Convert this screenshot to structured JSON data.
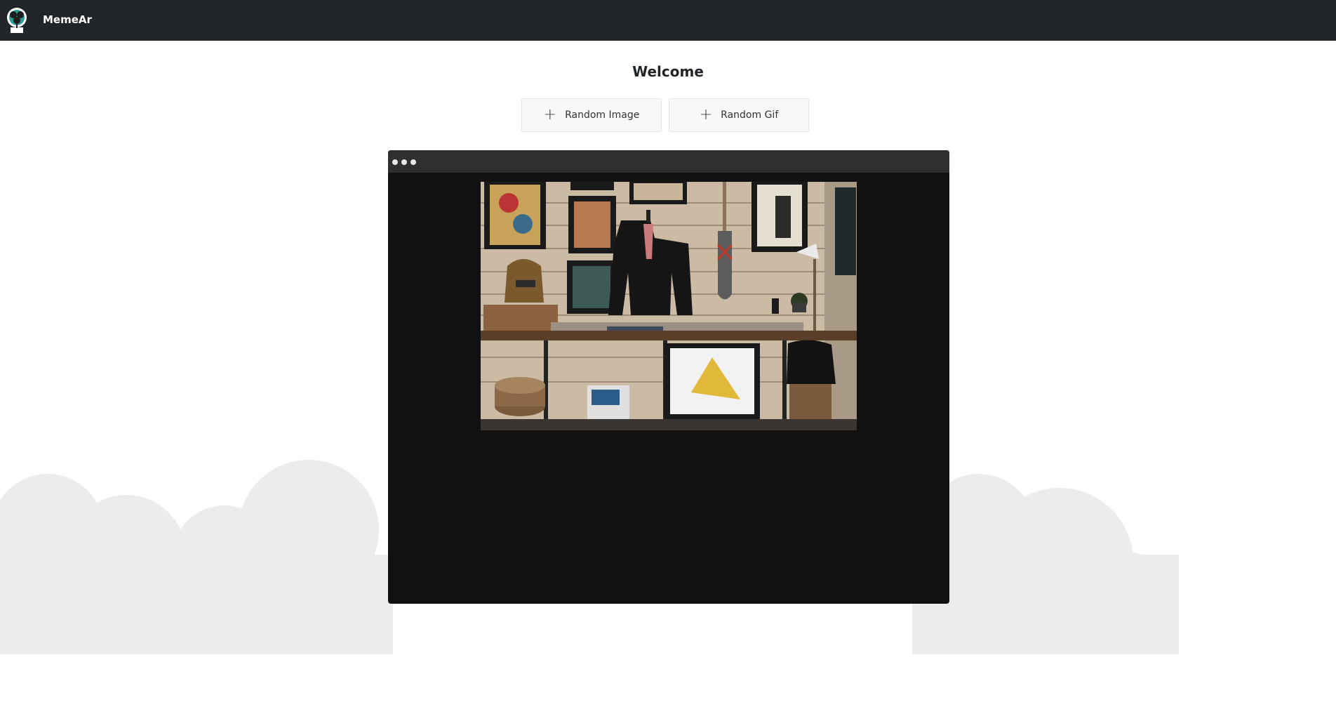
{
  "app": {
    "brand": "MemeAr",
    "logo_icon": "tree-globe-logo-icon"
  },
  "main": {
    "title": "Welcome",
    "buttons": {
      "random_image": "Random Image",
      "random_gif": "Random Gif",
      "plus_icon": "plus-icon"
    }
  },
  "viewer": {
    "dots_icon": "window-dots-icon",
    "image_alt": "Shop interior with framed art, jacket on wall, bench shelf and paddle"
  },
  "colors": {
    "topbar": "#212529",
    "viewer_bg": "#111111",
    "viewer_bar": "#2f2f2f",
    "cloud": "#ececec"
  }
}
